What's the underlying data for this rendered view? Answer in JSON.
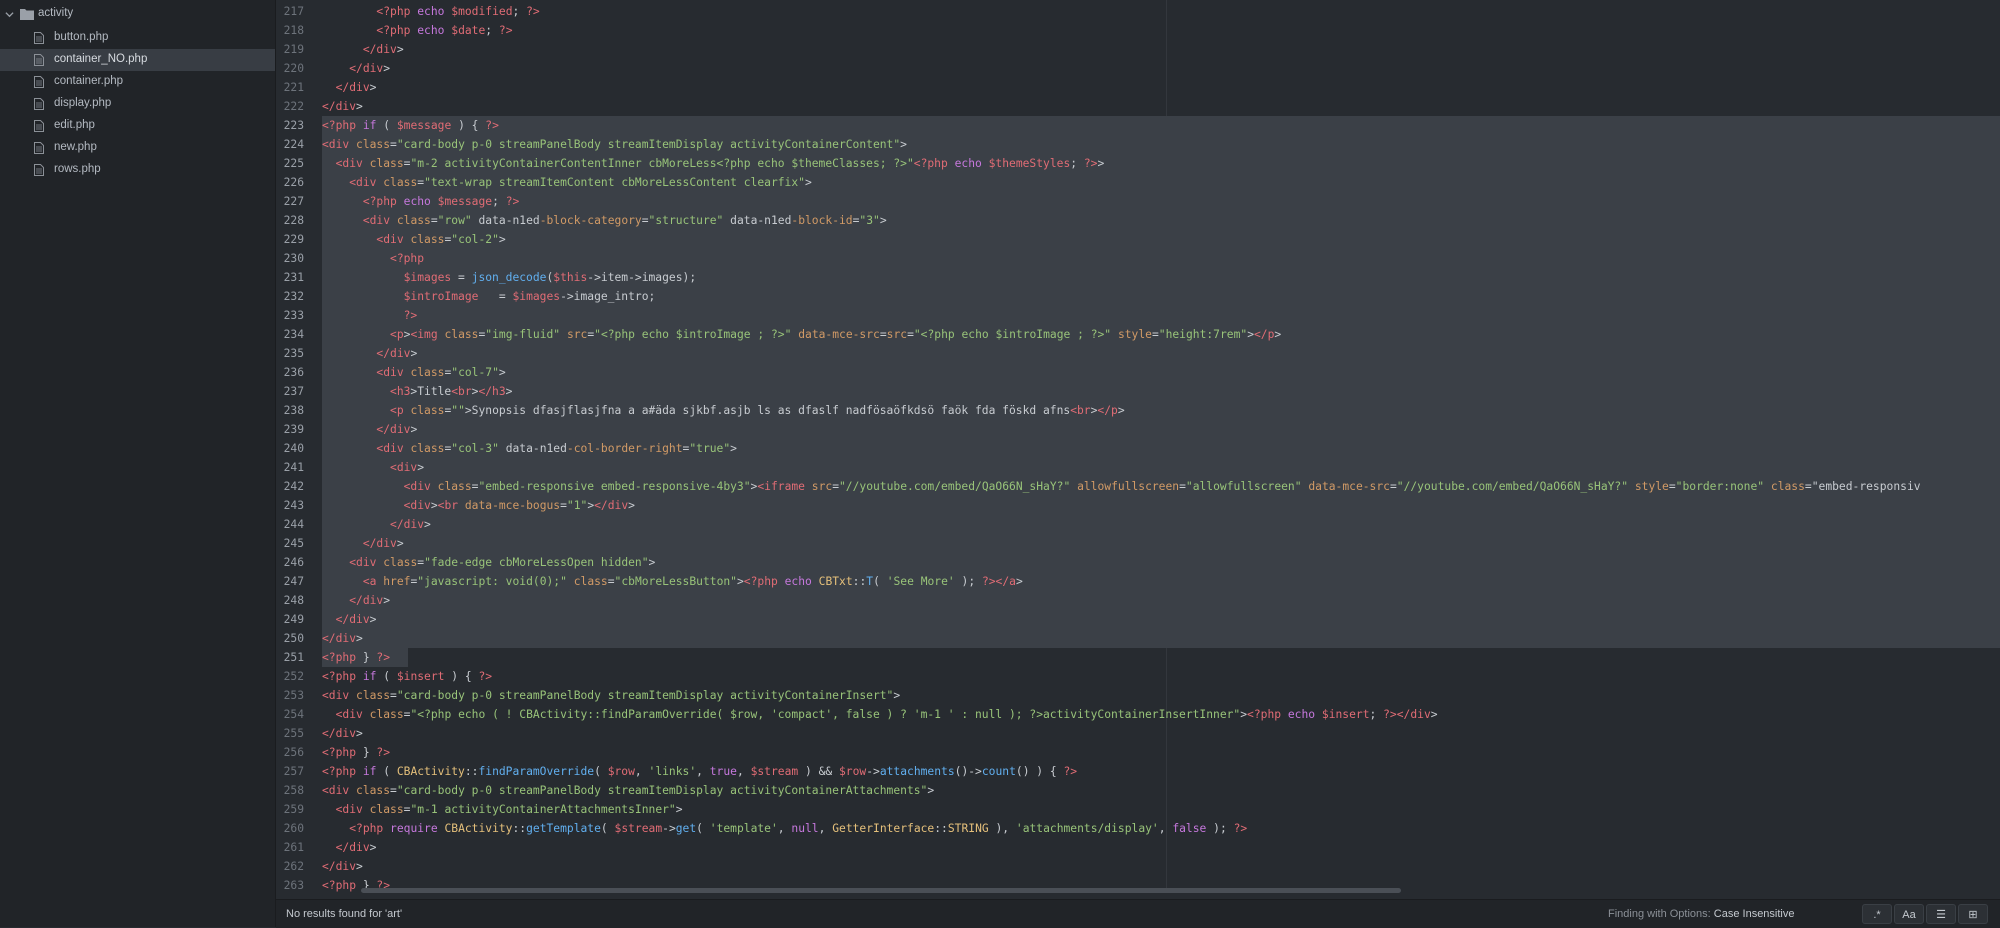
{
  "sidebar": {
    "folder": "activity",
    "files": [
      "button.php",
      "container_NO.php",
      "container.php",
      "display.php",
      "edit.php",
      "new.php",
      "rows.php"
    ],
    "selected_index": 1
  },
  "editor": {
    "first_line": 217,
    "selected_from": 223,
    "selected_to": 251,
    "lines": [
      "        <?php echo $modified; ?>",
      "        <?php echo $date; ?>",
      "      </div>",
      "    </div>",
      "  </div>",
      "</div>",
      "<?php if ( $message ) { ?>",
      "<div class=\"card-body p-0 streamPanelBody streamItemDisplay activityContainerContent\">",
      "  <div class=\"m-2 activityContainerContentInner cbMoreLess<?php echo $themeClasses; ?>\"<?php echo $themeStyles; ?>>",
      "    <div class=\"text-wrap streamItemContent cbMoreLessContent clearfix\">",
      "      <?php echo $message; ?>",
      "      <div class=\"row\" data-n1ed-block-category=\"structure\" data-n1ed-block-id=\"3\">",
      "        <div class=\"col-2\">",
      "          <?php",
      "            $images = json_decode($this->item->images);",
      "            $introImage   = $images->image_intro;",
      "            ?>",
      "          <p><img class=\"img-fluid\" src=\"<?php echo $introImage ; ?>\" data-mce-src=src=\"<?php echo $introImage ; ?>\" style=\"height:7rem\"></p>",
      "        </div>",
      "        <div class=\"col-7\">",
      "          <h3>Title<br></h3>",
      "          <p class=\"\">Synopsis dfasjflasjfna a a#äda sjkbf.asjb ls as dfaslf nadfösaöfkdsö faök fda föskd afns<br></p>",
      "        </div>",
      "        <div class=\"col-3\" data-n1ed-col-border-right=\"true\">",
      "          <div>",
      "            <div class=\"embed-responsive embed-responsive-4by3\"><iframe src=\"//youtube.com/embed/QaO66N_sHaY?\" allowfullscreen=\"allowfullscreen\" data-mce-src=\"//youtube.com/embed/QaO66N_sHaY?\" style=\"border:none\" class=\"embed-responsiv",
      "            <div><br data-mce-bogus=\"1\"></div>",
      "          </div>",
      "      </div>",
      "    <div class=\"fade-edge cbMoreLessOpen hidden\">",
      "      <a href=\"javascript: void(0);\" class=\"cbMoreLessButton\"><?php echo CBTxt::T( 'See More' ); ?></a>",
      "    </div>",
      "  </div>",
      "</div>",
      "<?php } ?>",
      "<?php if ( $insert ) { ?>",
      "<div class=\"card-body p-0 streamPanelBody streamItemDisplay activityContainerInsert\">",
      "  <div class=\"<?php echo ( ! CBActivity::findParamOverride( $row, 'compact', false ) ? 'm-1 ' : null ); ?>activityContainerInsertInner\"><?php echo $insert; ?></div>",
      "</div>",
      "<?php } ?>",
      "<?php if ( CBActivity::findParamOverride( $row, 'links', true, $stream ) && $row->attachments()->count() ) { ?>",
      "<div class=\"card-body p-0 streamPanelBody streamItemDisplay activityContainerAttachments\">",
      "  <div class=\"m-1 activityContainerAttachmentsInner\">",
      "    <?php require CBActivity::getTemplate( $stream->get( 'template', null, GetterInterface::STRING ), 'attachments/display', false ); ?>",
      "  </div>",
      "</div>",
      "<?php } ?>"
    ]
  },
  "findbar": {
    "status": "No results found for 'art'",
    "options_label": "Finding with Options:",
    "options_value": "Case Insensitive",
    "buttons": [
      ".*",
      "Aa",
      "☰",
      "⊞"
    ]
  },
  "colors": {
    "background": "#272b30",
    "sidebar": "#212428",
    "selection": "#3b4047"
  }
}
